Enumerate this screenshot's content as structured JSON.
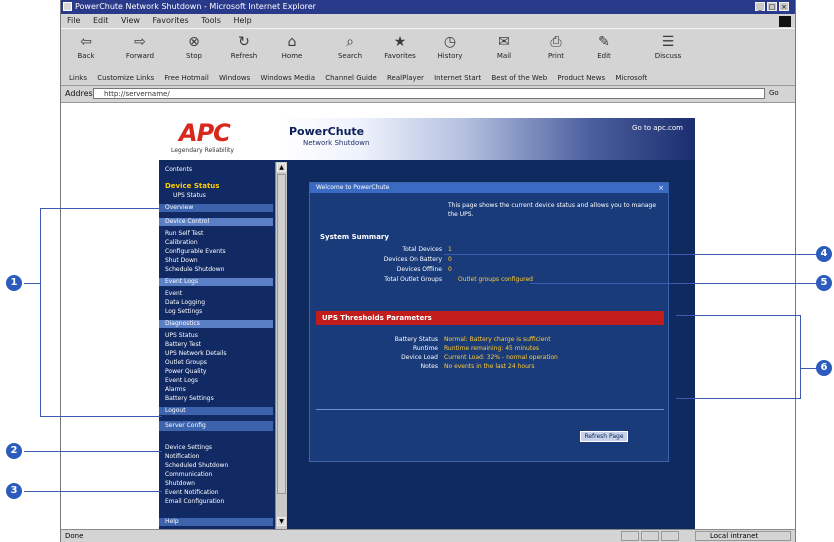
{
  "window": {
    "title": "PowerChute Network Shutdown - Microsoft Internet Explorer",
    "controls": [
      "_",
      "□",
      "×"
    ]
  },
  "menubar": {
    "items": [
      "File",
      "Edit",
      "View",
      "Favorites",
      "Tools",
      "Help"
    ]
  },
  "toolbar": {
    "buttons": [
      {
        "label": "Back",
        "icon": "back-arrow-icon"
      },
      {
        "label": "Forward",
        "icon": "forward-arrow-icon"
      },
      {
        "label": "Stop",
        "icon": "stop-icon"
      },
      {
        "label": "Refresh",
        "icon": "refresh-icon"
      },
      {
        "label": "Home",
        "icon": "home-icon"
      },
      {
        "label": "Search",
        "icon": "search-icon"
      },
      {
        "label": "Favorites",
        "icon": "favorites-icon"
      },
      {
        "label": "History",
        "icon": "history-icon"
      },
      {
        "label": "Mail",
        "icon": "mail-icon"
      },
      {
        "label": "Print",
        "icon": "print-icon"
      },
      {
        "label": "Edit",
        "icon": "edit-icon"
      },
      {
        "label": "Discuss",
        "icon": "discuss-icon"
      }
    ]
  },
  "links_bar": {
    "items": [
      "Links",
      "Customize Links",
      "Free Hotmail",
      "Windows",
      "Windows Media",
      "Channel Guide",
      "RealPlayer",
      "Internet Start",
      "Best of the Web",
      "Product News",
      "Microsoft"
    ]
  },
  "address_bar": {
    "label": "Address",
    "url": "http://servername/",
    "go": "Go"
  },
  "app_header": {
    "logo": "APC",
    "tagline": "Legendary Reliability",
    "product_title": "PowerChute",
    "product_subtitle": "Network Shutdown",
    "header_link": "Go to apc.com"
  },
  "sidebar": {
    "top_label": "Contents",
    "device_status": "Device Status",
    "device_sub": "UPS Status",
    "section_bar": "Overview",
    "subsections": [
      {
        "title": "Device Control",
        "items": [
          "Run Self Test",
          "Calibration",
          "Configurable Events",
          "Shut Down",
          "Schedule Shutdown"
        ]
      },
      {
        "title": "Event Logs",
        "items": [
          "Event",
          "Data Logging",
          "Log Settings"
        ]
      },
      {
        "title": "Diagnostics",
        "items": [
          "UPS Status",
          "Battery Test",
          "UPS Network Details",
          "Outlet Groups",
          "Power Quality",
          "Event Logs",
          "Alarms",
          "Battery Settings"
        ]
      }
    ],
    "bottom_bar": "Logout",
    "lower_section": "Server Config",
    "lower_items": [
      "Device Settings",
      "Notification",
      "Scheduled Shutdown",
      "Communication",
      "Shutdown",
      "Event Notification",
      "Email Configuration"
    ],
    "footer_bar": "Help"
  },
  "panel": {
    "title": "Welcome to PowerChute",
    "intro": "This page shows the current device status and allows you to manage the UPS.",
    "summary_heading": "System Summary",
    "summary_rows": [
      {
        "label": "Total Devices",
        "value": "1"
      },
      {
        "label": "Devices On Battery",
        "value": "0"
      },
      {
        "label": "Devices Offline",
        "value": "0"
      },
      {
        "label": "Total Outlet Groups",
        "value": "Outlet groups configured"
      }
    ],
    "red_heading": "UPS Thresholds Parameters",
    "threshold_rows": [
      {
        "label": "Battery Status",
        "value": "Normal: Battery charge is sufficient"
      },
      {
        "label": "Runtime",
        "value": "Runtime remaining: 45 minutes"
      },
      {
        "label": "Device Load",
        "value": "Current Load: 32% - normal operation"
      },
      {
        "label": "Notes",
        "value": "No events in the last 24 hours"
      }
    ],
    "button_label": "Refresh Page"
  },
  "callouts": [
    "1",
    "2",
    "3",
    "4",
    "5",
    "6"
  ],
  "status": {
    "left": "Done",
    "zone": "Local intranet"
  }
}
